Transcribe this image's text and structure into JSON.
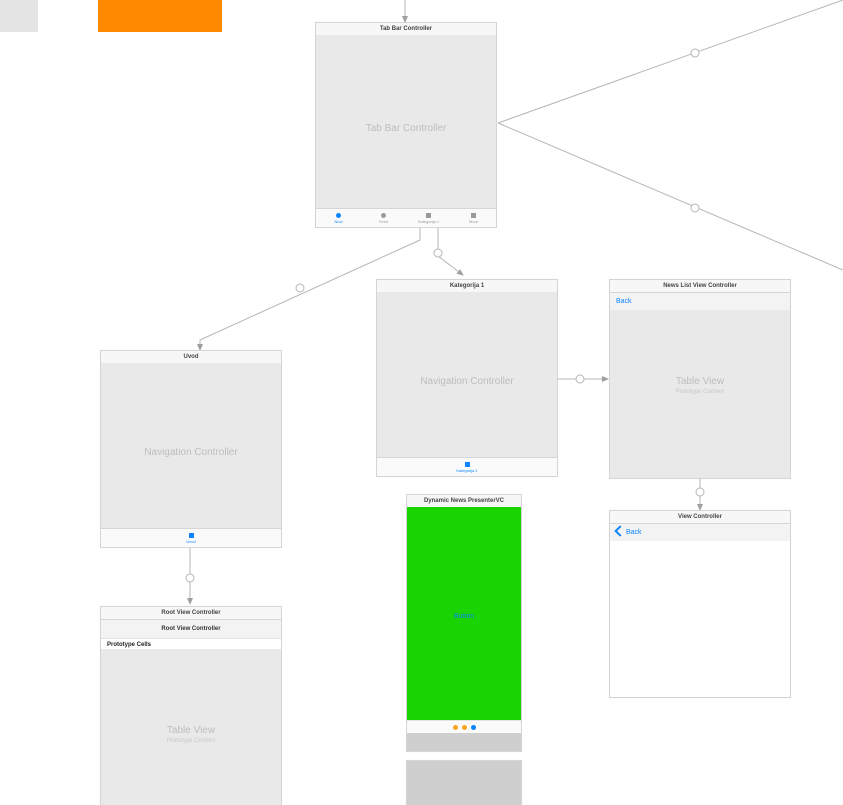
{
  "swatches": {
    "grey": "#e5e5e5",
    "orange": "#ff8a00"
  },
  "tab_bar_controller": {
    "title": "Tab Bar Controller",
    "center_label": "Tab Bar Controller",
    "tabs": [
      {
        "label": "Novi"
      },
      {
        "label": "Feed"
      },
      {
        "label": "Kategorija 1"
      },
      {
        "label": "More"
      }
    ]
  },
  "nav_uvod": {
    "title": "Uvod",
    "center_label": "Navigation Controller",
    "tab_label": "Uvod"
  },
  "root_vc": {
    "title": "Root View Controller",
    "nav_title": "Root View Controller",
    "section": "Prototype Cells",
    "table_label": "Table View",
    "table_sub": "Prototype Content"
  },
  "nav_kategorija": {
    "title": "Kategorija 1",
    "center_label": "Navigation Controller",
    "tab_label": "Kategorija 1"
  },
  "dynamic_news": {
    "title": "Dynamic News PresenterVC",
    "button_label": "Button",
    "pager_colors": [
      "#f5a623",
      "#f5a623",
      "#0a84ff"
    ]
  },
  "news_list": {
    "title": "News List View Controller",
    "back": "Back",
    "table_label": "Table View",
    "table_sub": "Prototype Content"
  },
  "view_controller": {
    "title": "View Controller",
    "back": "Back"
  }
}
